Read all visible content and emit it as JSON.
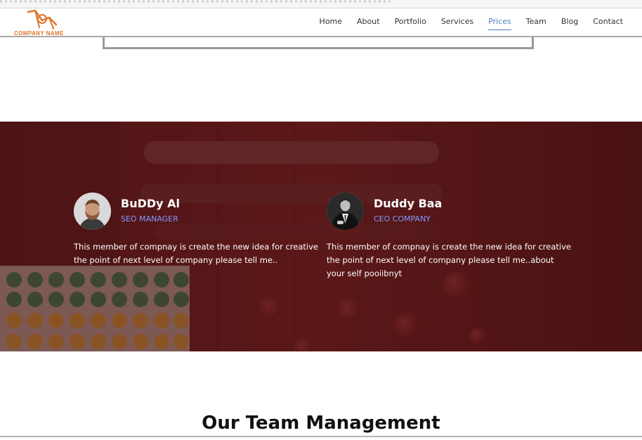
{
  "header": {
    "logo_text": "COMPANY NAME",
    "nav": [
      {
        "label": "Home"
      },
      {
        "label": "About"
      },
      {
        "label": "Portfolio"
      },
      {
        "label": "Services"
      },
      {
        "label": "Prices",
        "active": true
      },
      {
        "label": "Team"
      },
      {
        "label": "Blog"
      },
      {
        "label": "Contact"
      }
    ]
  },
  "team": {
    "members": [
      {
        "name": "BuDDy Al",
        "role": "SEO MANAGER",
        "description": "This member of compnay is create the new idea for creative the point of next level of company please tell me.."
      },
      {
        "name": "Duddy Baa",
        "role": "CEO COMPANY",
        "description": "This member of compnay is create the new idea for creative the point of next level of company please tell me..about your self pooiibnyt"
      }
    ]
  },
  "management": {
    "title": "Our Team Management"
  },
  "colors": {
    "accent": "#4a7fbf",
    "role": "#7f9bff",
    "logo": "#e0742a",
    "band": "#4a1717"
  }
}
